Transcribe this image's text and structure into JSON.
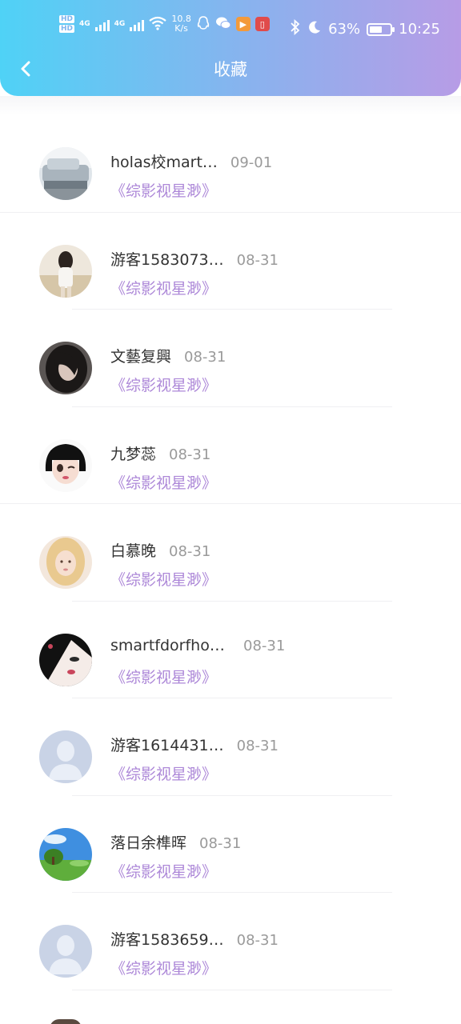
{
  "status_bar": {
    "hd1": "HD",
    "hd2": "HD",
    "net1": "4G",
    "net2": "4G",
    "speed": "10.8",
    "speed_unit": "K/s",
    "battery": "63%",
    "battery_level": 0.63,
    "time": "10:25"
  },
  "header": {
    "title": "收藏"
  },
  "items": [
    {
      "name": "holas校mart…",
      "date": "09-01",
      "work": "《综影视星渺》",
      "avatar": "car-photo"
    },
    {
      "name": "游客1583073…",
      "date": "08-31",
      "work": "《综影视星渺》",
      "avatar": "girl-field-photo"
    },
    {
      "name": "文藝复興",
      "date": "08-31",
      "work": "《综影视星渺》",
      "avatar": "dark-hair-photo"
    },
    {
      "name": "九梦蕊",
      "date": "08-31",
      "work": "《综影视星渺》",
      "avatar": "anime-girl-photo"
    },
    {
      "name": "白慕晚",
      "date": "08-31",
      "work": "《综影视星渺》",
      "avatar": "blonde-girl-photo"
    },
    {
      "name": "smartfdorfhourd",
      "date": "08-31",
      "work": "《综影视星渺》",
      "avatar": "face-closeup-photo"
    },
    {
      "name": "游客1614431…",
      "date": "08-31",
      "work": "《综影视星渺》",
      "avatar": "default-user"
    },
    {
      "name": "落日余榫晖",
      "date": "08-31",
      "work": "《综影视星渺》",
      "avatar": "landscape-photo"
    },
    {
      "name": "游客1583659…",
      "date": "08-31",
      "work": "《综影视星渺》",
      "avatar": "default-user"
    }
  ],
  "colors": {
    "header_gradient": [
      "#4fd2f6",
      "#8ab2ee",
      "#b79ce6"
    ],
    "work_title": "#ad88d8",
    "date": "#9a9a9a"
  }
}
